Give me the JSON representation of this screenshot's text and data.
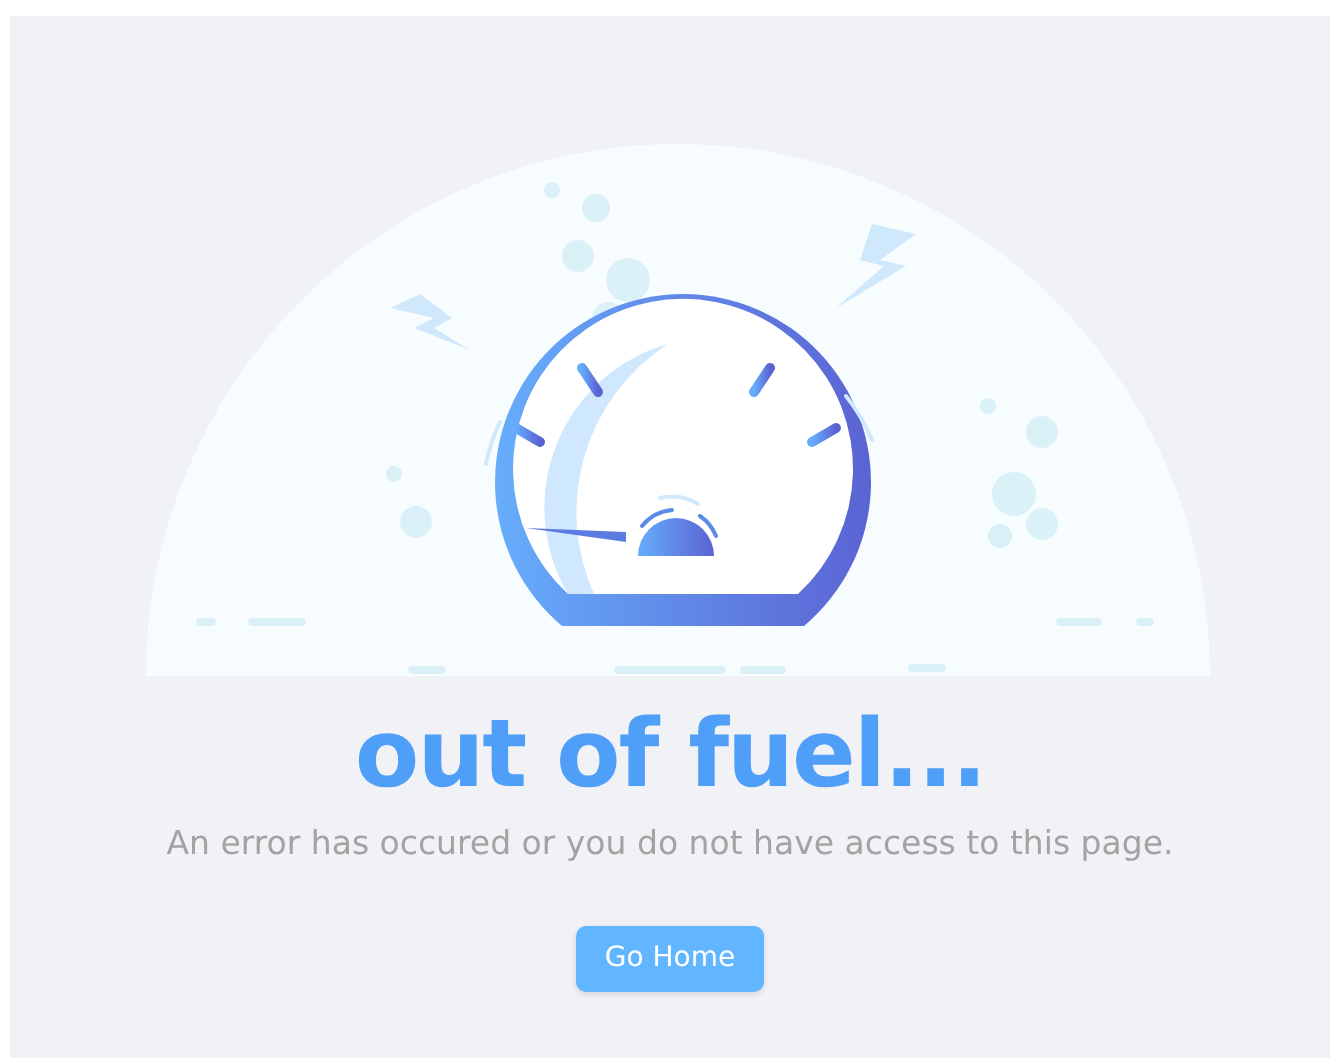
{
  "title": "out of fuel...",
  "message": "An error has occured or you do not have access to this page.",
  "button": {
    "label": "Go Home"
  }
}
